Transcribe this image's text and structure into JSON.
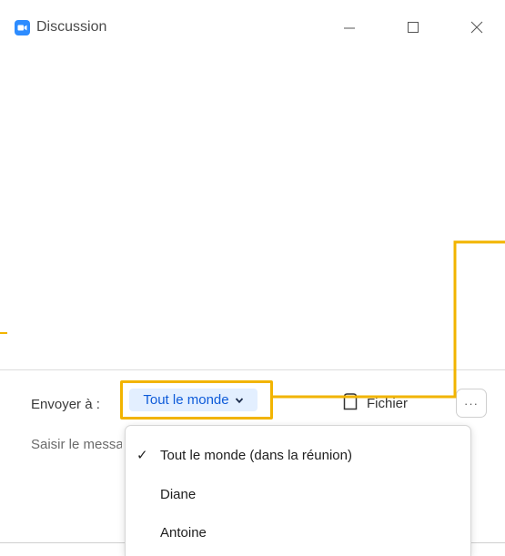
{
  "window": {
    "title": "Discussion",
    "accent_color": "#2d8cff",
    "highlight_color": "#f2b400"
  },
  "icons": {
    "app": "zoom-camera-icon",
    "minimize": "minimize-icon",
    "maximize": "maximize-icon",
    "close": "close-icon",
    "chevron": "chevron-down-icon",
    "file": "file-icon",
    "more": "more-icon",
    "check": "checkmark-icon"
  },
  "composer": {
    "send_to_label": "Envoyer à :",
    "recipient": "Tout le monde",
    "file_label": "Fichier",
    "more_label": "···",
    "message_placeholder": "Saisir le message ici..."
  },
  "dropdown": {
    "options": [
      {
        "label": "Tout le monde (dans la réunion)",
        "selected": true
      },
      {
        "label": "Diane",
        "selected": false
      },
      {
        "label": "Antoine",
        "selected": false
      }
    ]
  }
}
